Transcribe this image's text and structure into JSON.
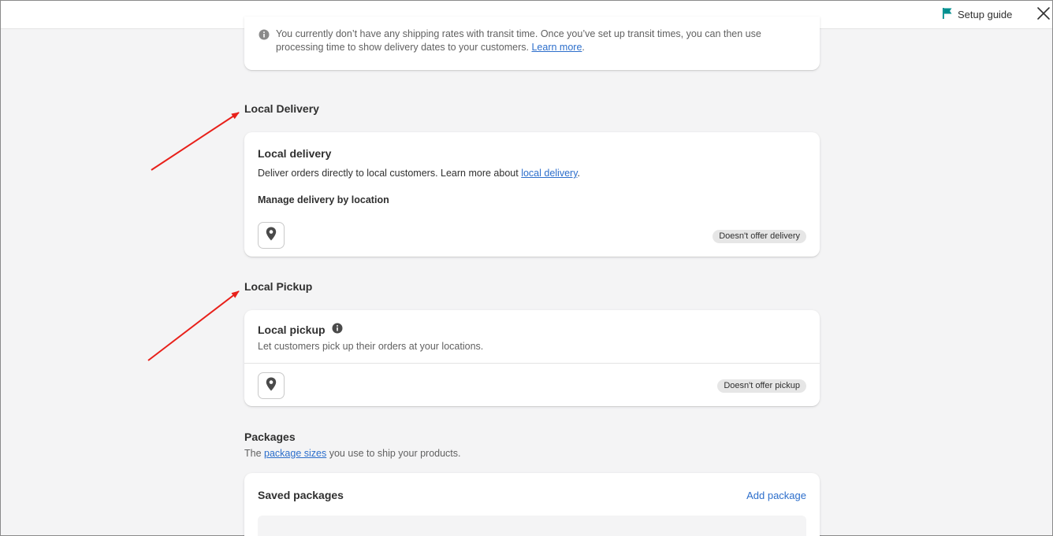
{
  "topbar": {
    "setup_guide_label": "Setup guide"
  },
  "transit_notice": {
    "text": "You currently don’t have any shipping rates with transit time. Once you’ve set up transit times, you can then use processing time to show delivery dates to your customers.",
    "link": "Learn more"
  },
  "local_delivery": {
    "section_title": "Local Delivery",
    "card_title": "Local delivery",
    "description_prefix": "Deliver orders directly to local customers. Learn more about",
    "description_link": "local delivery",
    "manage_label": "Manage delivery by location",
    "status_badge": "Doesn't offer delivery"
  },
  "local_pickup": {
    "section_title": "Local Pickup",
    "card_title": "Local pickup",
    "description": "Let customers pick up their orders at your locations.",
    "status_badge": "Doesn't offer pickup"
  },
  "packages": {
    "section_title": "Packages",
    "description_prefix": "The",
    "description_link": "package sizes",
    "description_suffix": "you use to ship your products.",
    "card_title": "Saved packages",
    "add_label": "Add package"
  },
  "colors": {
    "link": "#2c6ecb",
    "annotation_arrow": "#e8201a",
    "flag": "#008f8f"
  },
  "icons": [
    "flag-icon",
    "close-icon",
    "info-icon",
    "location-pin-icon"
  ]
}
